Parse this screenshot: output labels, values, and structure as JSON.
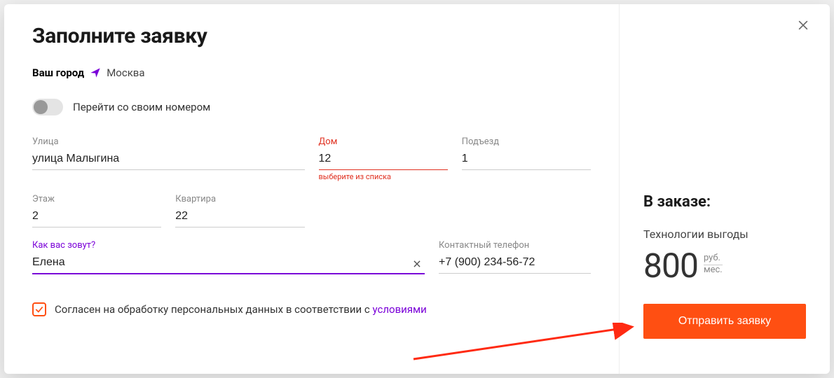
{
  "modal": {
    "title": "Заполните заявку",
    "city_label": "Ваш город",
    "city_name": "Москва",
    "toggle_label": "Перейти со своим номером"
  },
  "fields": {
    "street": {
      "label": "Улица",
      "value": "улица Малыгина"
    },
    "house": {
      "label": "Дом",
      "value": "12",
      "helper": "выберите из списка"
    },
    "entrance": {
      "label": "Подъезд",
      "value": "1"
    },
    "floor": {
      "label": "Этаж",
      "value": "2"
    },
    "apartment": {
      "label": "Квартира",
      "value": "22"
    },
    "name": {
      "label": "Как вас зовут?",
      "value": "Елена"
    },
    "phone": {
      "label": "Контактный телефон",
      "value": "+7 (900) 234-56-72"
    }
  },
  "consent": {
    "text": "Согласен на обработку персональных данных в соответствии с ",
    "link": "условиями",
    "checked": true
  },
  "order": {
    "heading": "В заказе:",
    "plan_name": "Технологии выгоды",
    "price": "800",
    "currency": "руб.",
    "period": "мес.",
    "submit": "Отправить заявку"
  },
  "colors": {
    "accent": "#ff4f12",
    "focus": "#7a00d8",
    "error": "#e03020"
  }
}
